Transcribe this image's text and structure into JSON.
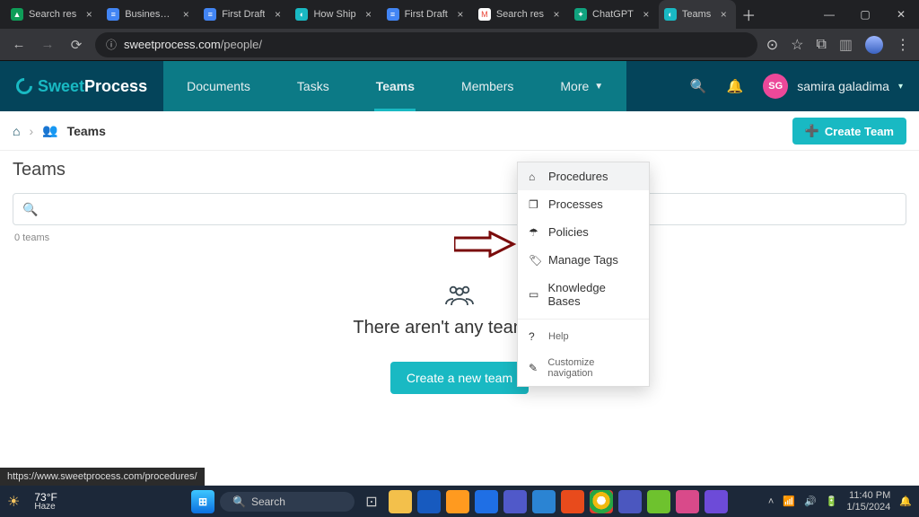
{
  "browser": {
    "tabs": [
      {
        "label": "Search res",
        "color": "#0f9d58"
      },
      {
        "label": "Business P",
        "color": "#4285f4"
      },
      {
        "label": "First Draft",
        "color": "#4285f4"
      },
      {
        "label": "How Ship",
        "color": "#19b9c3"
      },
      {
        "label": "First Draft",
        "color": "#4285f4"
      },
      {
        "label": "Search res",
        "color": "#ea4335"
      },
      {
        "label": "ChatGPT",
        "color": "#10a37f"
      },
      {
        "label": "Teams",
        "color": "#19b9c3"
      }
    ],
    "active_tab_index": 7,
    "url_host": "sweetprocess.com",
    "url_path": "/people/",
    "status_url": "https://www.sweetprocess.com/procedures/"
  },
  "app": {
    "logo_a": "Sweet",
    "logo_b": "Process",
    "nav": {
      "documents": "Documents",
      "tasks": "Tasks",
      "teams": "Teams",
      "members": "Members",
      "more": "More"
    },
    "user": {
      "initials": "SG",
      "name": "samira galadima"
    }
  },
  "dropdown": {
    "procedures": "Procedures",
    "processes": "Processes",
    "policies": "Policies",
    "manage_tags": "Manage Tags",
    "knowledge_bases": "Knowledge Bases",
    "help": "Help",
    "customize": "Customize navigation"
  },
  "page": {
    "crumb_current": "Teams",
    "create_team": "Create Team",
    "title": "Teams",
    "search_placeholder": "",
    "count": "0 teams",
    "empty_text": "There aren't any teams yet",
    "create_new": "Create a new team"
  },
  "taskbar": {
    "temp": "73°F",
    "cond": "Haze",
    "search_label": "Search",
    "time": "11:40 PM",
    "date": "1/15/2024"
  }
}
